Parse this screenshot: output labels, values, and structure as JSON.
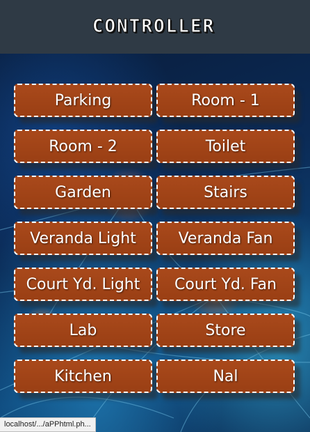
{
  "header": {
    "title": "CONTROLLER"
  },
  "buttons": [
    {
      "label": "Parking"
    },
    {
      "label": "Room - 1"
    },
    {
      "label": "Room - 2"
    },
    {
      "label": "Toilet"
    },
    {
      "label": "Garden"
    },
    {
      "label": "Stairs"
    },
    {
      "label": "Veranda Light"
    },
    {
      "label": "Veranda Fan"
    },
    {
      "label": "Court Yd. Light"
    },
    {
      "label": "Court Yd. Fan"
    },
    {
      "label": "Lab"
    },
    {
      "label": "Store"
    },
    {
      "label": "Kitchen"
    },
    {
      "label": "Nal"
    }
  ],
  "status_bar": {
    "url": "localhost/.../aPPhtml.ph..."
  },
  "colors": {
    "button_fill": "#a9491b",
    "header_bg": "#2f3a45",
    "button_border": "#ffffff"
  }
}
